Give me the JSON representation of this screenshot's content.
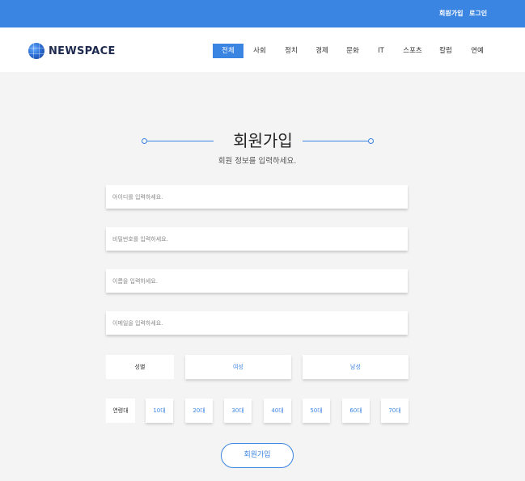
{
  "topbar": {
    "signup": "회원가입",
    "login": "로그인"
  },
  "logo": {
    "text": "NEWSPACE"
  },
  "nav": [
    "전체",
    "사회",
    "정치",
    "경제",
    "문화",
    "IT",
    "스포츠",
    "칼럼",
    "연예"
  ],
  "form": {
    "title": "회원가입",
    "subtitle": "회원 정보를 입력하세요.",
    "id_placeholder": "아이디를 입력하세요.",
    "pw_placeholder": "비밀번호를 입력하세요.",
    "name_placeholder": "이름을 입력하세요.",
    "email_placeholder": "이메일을 입력하세요.",
    "gender_label": "성별",
    "gender_options": [
      "여성",
      "남성"
    ],
    "age_label": "연령대",
    "age_options": [
      "10대",
      "20대",
      "30대",
      "40대",
      "50대",
      "60대",
      "70대"
    ],
    "submit": "회원가입"
  },
  "colors": {
    "accent": "#3a84e2",
    "background": "#f4f4f4"
  }
}
